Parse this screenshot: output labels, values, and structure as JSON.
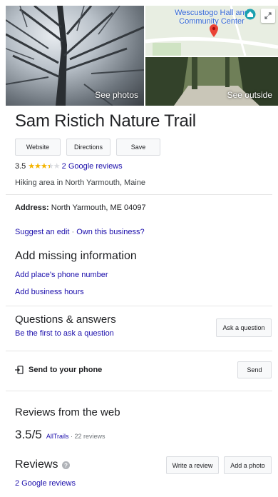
{
  "photos": {
    "see_photos_label": "See photos",
    "see_outside_label": "See outside",
    "map_label": "Wescustogo Hall and Community Center",
    "icons": [
      "expand-icon",
      "map-pin-icon",
      "building-icon"
    ]
  },
  "place": {
    "name": "Sam Ristich Nature Trail",
    "rating": "3.5",
    "rating_value": 3.5,
    "reviews_link": "2 Google reviews",
    "category": "Hiking area in North Yarmouth, Maine"
  },
  "actions": {
    "website": "Website",
    "directions": "Directions",
    "save": "Save"
  },
  "address": {
    "label": "Address:",
    "value": "North Yarmouth, ME 04097"
  },
  "edit": {
    "suggest": "Suggest an edit",
    "separator": " · ",
    "own": "Own this business?"
  },
  "missing": {
    "heading": "Add missing information",
    "phone": "Add place's phone number",
    "hours": "Add business hours"
  },
  "qa": {
    "heading": "Questions & answers",
    "first": "Be the first to ask a question",
    "ask_button": "Ask a question"
  },
  "send": {
    "label": "Send to your phone",
    "button": "Send",
    "icon": "send-to-phone-icon"
  },
  "web_reviews": {
    "heading": "Reviews from the web",
    "score": "3.5/5",
    "source": "AllTrails",
    "count": " · 22 reviews"
  },
  "reviews": {
    "heading": "Reviews",
    "link": "2 Google reviews",
    "write_button": "Write a review",
    "add_photo_button": "Add a photo",
    "icon": "help-icon"
  }
}
